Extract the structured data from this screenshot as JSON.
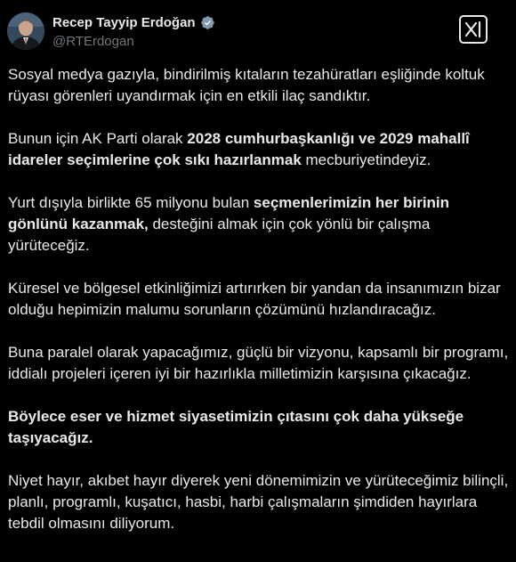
{
  "author": {
    "display_name": "Recep Tayyip Erdoğan",
    "handle": "@RTErdogan",
    "verified_badge_icon": "verified-badge-icon",
    "badge_color": "#829aab"
  },
  "actions": {
    "grok_icon": "grok-icon"
  },
  "colors": {
    "background": "#000000",
    "text": "#e7e9ea",
    "secondary_text": "#71767b"
  },
  "tweet": {
    "p1": "Sosyal medya gazıyla, bindirilmiş kıtaların tezahüratları eşliğinde koltuk rüyası görenleri uyandırmak için en etkili ilaç sandıktır.",
    "p2_a": "Bunun için AK Parti olarak ",
    "p2_b": "2028 cumhurbaşkanlığı ve 2029 mahallî idareler seçimlerine çok sıkı hazırlanmak",
    "p2_c": " mecburiyetindeyiz.",
    "p3_a": "Yurt dışıyla birlikte 65 milyonu bulan ",
    "p3_b": "seçmenlerimizin her birinin gönlünü kazanmak,",
    "p3_c": " desteğini almak için çok yönlü bir çalışma yürüteceğiz.",
    "p4": "Küresel ve bölgesel etkinliğimizi artırırken bir yandan da insanımızın bizar olduğu hepimizin malumu sorunların çözümünü hızlandıracağız.",
    "p5": "Buna paralel olarak yapacağımız, güçlü bir vizyonu, kapsamlı bir programı, iddialı projeleri içeren iyi bir hazırlıkla milletimizin karşısına çıkacağız.",
    "p6": "Böylece eser ve hizmet siyasetimizin çıtasını çok daha yükseğe taşıyacağız.",
    "p7": "Niyet hayır, akıbet hayır diyerek yeni dönemimizin ve yürüteceğimiz bilinçli, planlı, programlı, kuşatıcı, hasbi, harbi çalışmaların şimdiden hayırlara tebdil olmasını diliyorum."
  }
}
